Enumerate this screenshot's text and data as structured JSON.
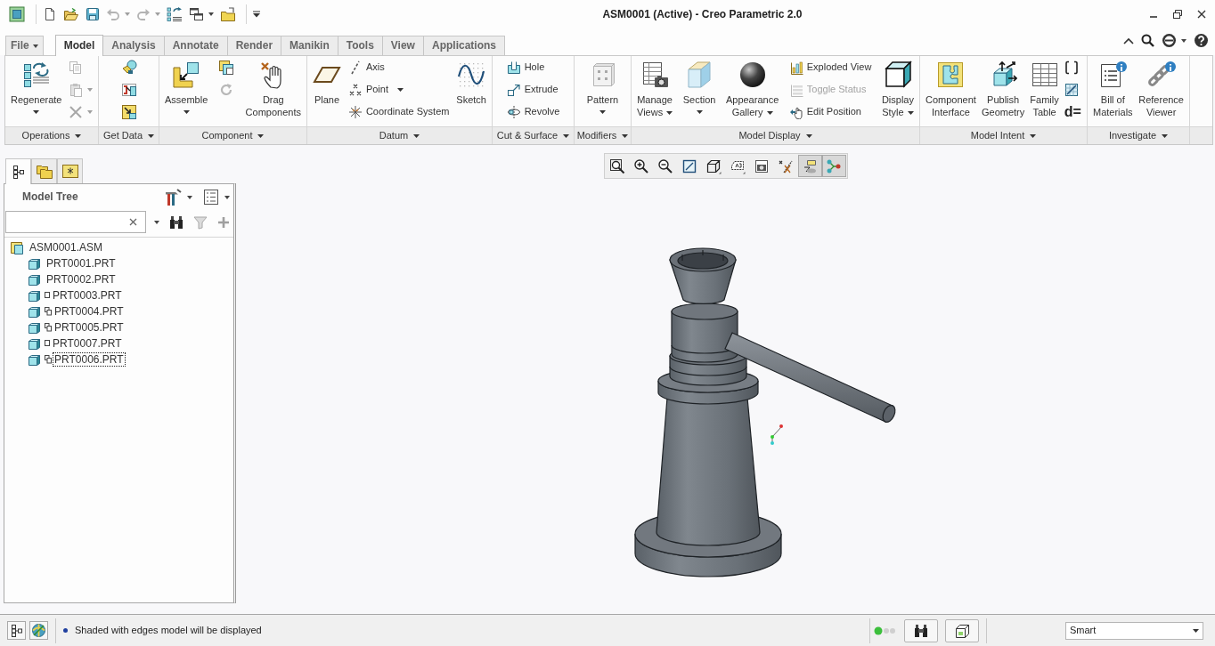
{
  "window": {
    "title": "ASM0001 (Active) - Creo Parametric 2.0"
  },
  "quick_access": [
    {
      "disabled": false
    },
    {
      "disabled": false
    },
    {
      "disabled": false
    },
    {
      "disabled": true
    },
    {
      "disabled": true
    },
    {
      "disabled": false
    },
    {
      "disabled": false
    },
    {
      "disabled": false
    }
  ],
  "ribbon_tabs": [
    {
      "label": "File",
      "kind": "menu",
      "selected": false
    },
    {
      "label": "Model",
      "kind": "tab",
      "selected": true
    },
    {
      "label": "Analysis",
      "kind": "tab",
      "selected": false
    },
    {
      "label": "Annotate",
      "kind": "tab",
      "selected": false
    },
    {
      "label": "Render",
      "kind": "tab",
      "selected": false
    },
    {
      "label": "Manikin",
      "kind": "tab",
      "selected": false
    },
    {
      "label": "Tools",
      "kind": "tab",
      "selected": false
    },
    {
      "label": "View",
      "kind": "tab",
      "selected": false
    },
    {
      "label": "Applications",
      "kind": "tab",
      "selected": false
    }
  ],
  "ribbon_groups": [
    {
      "label": "Operations",
      "columns": [
        [
          {
            "kind": "large",
            "label": "Regenerate",
            "caret": true,
            "disabled": false
          }
        ],
        [
          {
            "kind": "icon",
            "caret": false,
            "disabled": true
          },
          {
            "kind": "icon",
            "caret": true,
            "disabled": true
          },
          {
            "kind": "icon",
            "caret": true,
            "disabled": true
          }
        ]
      ]
    },
    {
      "label": "Get Data",
      "columns": [
        [
          {
            "kind": "icon",
            "caret": false,
            "disabled": false
          },
          {
            "kind": "icon",
            "caret": false,
            "disabled": false
          },
          {
            "kind": "icon",
            "caret": false,
            "disabled": false
          }
        ]
      ]
    },
    {
      "label": "Component",
      "columns": [
        [
          {
            "kind": "large",
            "label": "Assemble",
            "caret": true,
            "disabled": false
          }
        ],
        [
          {
            "kind": "icon",
            "caret": false,
            "disabled": false
          },
          {
            "kind": "icon",
            "caret": false,
            "disabled": true
          }
        ],
        [
          {
            "kind": "large",
            "label": "Drag Components",
            "caret": false,
            "disabled": false
          }
        ]
      ]
    },
    {
      "label": "Datum",
      "columns": [
        [
          {
            "kind": "large",
            "label": "Plane",
            "caret": false,
            "disabled": false
          }
        ],
        [
          {
            "kind": "small",
            "label": "Axis",
            "caret": false,
            "disabled": false
          },
          {
            "kind": "small",
            "label": "Point",
            "caret": true,
            "disabled": false
          },
          {
            "kind": "small",
            "label": "Coordinate System",
            "caret": false,
            "disabled": false
          }
        ],
        [
          {
            "kind": "large",
            "label": "Sketch",
            "caret": false,
            "disabled": false
          }
        ]
      ]
    },
    {
      "label": "Cut & Surface",
      "columns": [
        [
          {
            "kind": "small",
            "label": "Hole",
            "caret": false,
            "disabled": false
          },
          {
            "kind": "small",
            "label": "Extrude",
            "caret": false,
            "disabled": false
          },
          {
            "kind": "small",
            "label": "Revolve",
            "caret": false,
            "disabled": false
          }
        ]
      ]
    },
    {
      "label": "Modifiers",
      "columns": [
        [
          {
            "kind": "large",
            "label": "Pattern",
            "caret": true,
            "disabled": false
          }
        ]
      ]
    },
    {
      "label": "Model Display",
      "columns": [
        [
          {
            "kind": "large",
            "label": "Manage Views",
            "caret": true,
            "disabled": false
          }
        ],
        [
          {
            "kind": "large",
            "label": "Section",
            "caret": true,
            "disabled": false
          }
        ],
        [
          {
            "kind": "large",
            "label": "Appearance Gallery",
            "caret": true,
            "disabled": false
          }
        ],
        [
          {
            "kind": "small",
            "label": "Exploded View",
            "caret": false,
            "disabled": false
          },
          {
            "kind": "small",
            "label": "Toggle Status",
            "caret": false,
            "disabled": true
          },
          {
            "kind": "small",
            "label": "Edit Position",
            "caret": false,
            "disabled": false
          }
        ],
        [
          {
            "kind": "large",
            "label": "Display Style",
            "caret": true,
            "disabled": false
          }
        ]
      ]
    },
    {
      "label": "Model Intent",
      "columns": [
        [
          {
            "kind": "large",
            "label": "Component Interface",
            "caret": false,
            "disabled": false
          }
        ],
        [
          {
            "kind": "large",
            "label": "Publish Geometry",
            "caret": false,
            "disabled": false
          }
        ],
        [
          {
            "kind": "large",
            "label": "Family Table",
            "caret": false,
            "disabled": false
          }
        ],
        [
          {
            "kind": "icon",
            "caret": false,
            "disabled": false
          },
          {
            "kind": "icon",
            "caret": false,
            "disabled": false
          },
          {
            "kind": "glyph",
            "label": "d=",
            "caret": false,
            "disabled": false
          }
        ]
      ]
    },
    {
      "label": "Investigate",
      "columns": [
        [
          {
            "kind": "large",
            "label": "Bill of Materials",
            "caret": false,
            "disabled": false
          }
        ],
        [
          {
            "kind": "large",
            "label": "Reference Viewer",
            "caret": false,
            "disabled": false
          }
        ]
      ]
    }
  ],
  "navigator_tabs": [
    {
      "selected": true
    },
    {
      "selected": false
    },
    {
      "selected": false
    }
  ],
  "model_tree": {
    "title": "Model Tree",
    "tools": [
      {
        "disabled": false
      },
      {
        "disabled": true
      },
      {
        "disabled": true
      }
    ],
    "items": [
      {
        "label": "ASM0001.ASM",
        "kind": "assembly",
        "selected": false,
        "children": [
          {
            "label": "PRT0001.PRT",
            "kind": "plain",
            "selected": false
          },
          {
            "label": "PRT0002.PRT",
            "kind": "plain",
            "selected": false
          },
          {
            "label": "PRT0003.PRT",
            "kind": "boxed",
            "selected": false
          },
          {
            "label": "PRT0004.PRT",
            "kind": "stacked",
            "selected": false
          },
          {
            "label": "PRT0005.PRT",
            "kind": "stacked",
            "selected": false
          },
          {
            "label": "PRT0007.PRT",
            "kind": "boxed",
            "selected": false
          },
          {
            "label": "PRT0006.PRT",
            "kind": "stacked",
            "selected": true
          }
        ]
      }
    ]
  },
  "view_toolbar": [
    {
      "on": false
    },
    {
      "on": false
    },
    {
      "on": false
    },
    {
      "on": false
    },
    {
      "on": false
    },
    {
      "on": false
    },
    {
      "on": false
    },
    {
      "on": false
    },
    {
      "on": true
    },
    {
      "on": true
    }
  ],
  "status_bar": {
    "message": "Shaded with edges model will be displayed",
    "selection_filter": "Smart"
  }
}
